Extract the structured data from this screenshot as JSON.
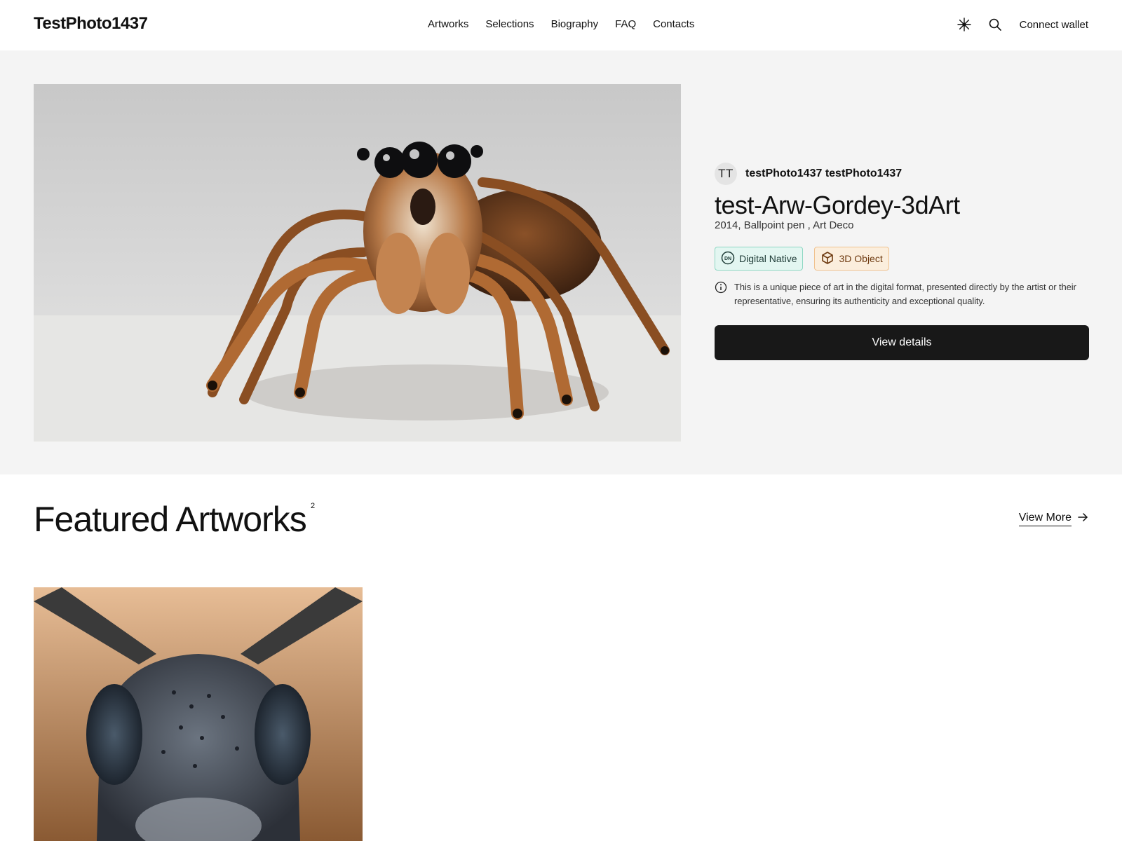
{
  "header": {
    "logo": "TestPhoto1437",
    "nav": [
      "Artworks",
      "Selections",
      "Biography",
      "FAQ",
      "Contacts"
    ],
    "connect_wallet": "Connect wallet",
    "icons": [
      "theme-toggle-icon",
      "search-icon"
    ]
  },
  "hero": {
    "artist_initials": "TT",
    "artist_name": "testPhoto1437 testPhoto1437",
    "title": "test-Arw-Gordey-3dArt",
    "meta": "2014, Ballpoint pen , Art Deco",
    "tags": [
      {
        "label": "Digital Native",
        "icon": "dn-icon",
        "color": "#e3f6f1"
      },
      {
        "label": "3D Object",
        "icon": "cube-icon",
        "color": "#fbeedd"
      }
    ],
    "notice": "This is a unique piece of art in the digital format, presented directly by the artist or their representative, ensuring its authenticity and exceptional quality.",
    "cta": "View details",
    "image": "jumping-spider-photo"
  },
  "featured": {
    "title": "Featured Artworks",
    "count": "2",
    "view_more": "View More",
    "cards": [
      {
        "image": "beetle-head-photo"
      }
    ]
  },
  "colors": {
    "hero_bg": "#f4f4f4",
    "button_bg": "#181818",
    "text": "#111111"
  }
}
